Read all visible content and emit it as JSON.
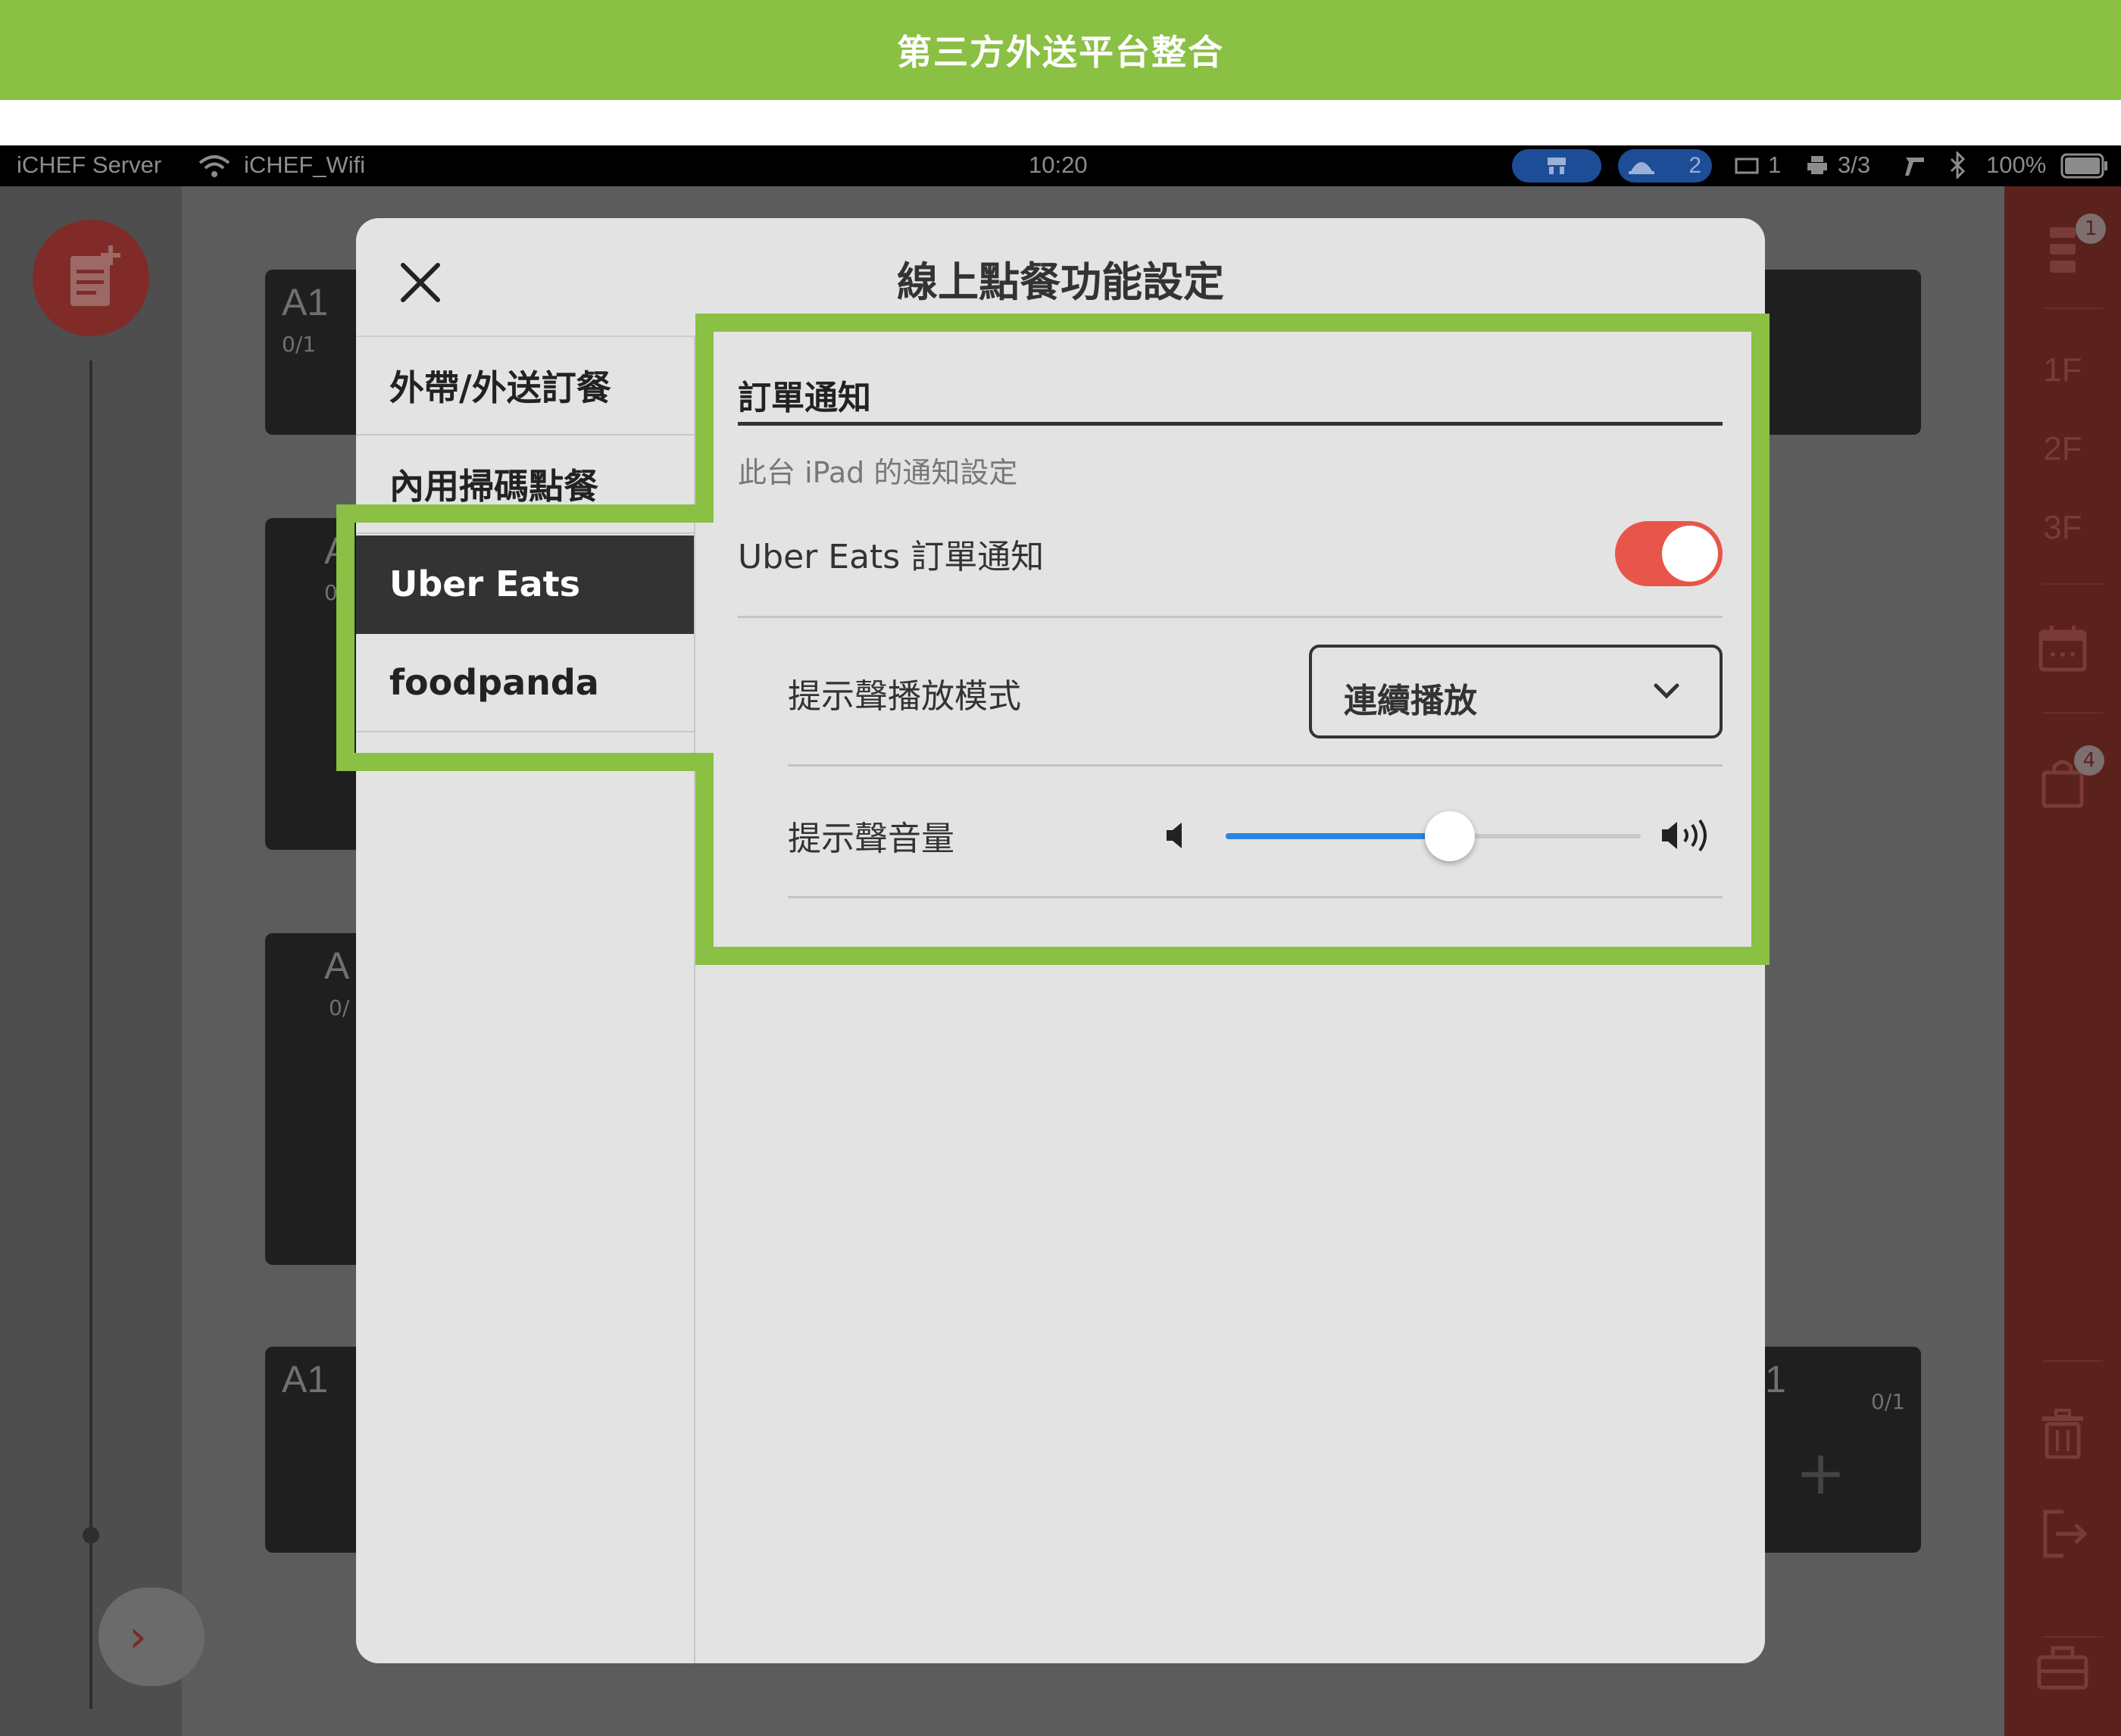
{
  "banner": {
    "title": "第三方外送平台整合"
  },
  "status_bar": {
    "server": "iCHEF Server",
    "wifi": "iCHEF_Wifi",
    "time": "10:20",
    "pill2_count": "2",
    "drawer_count": "1",
    "printer_count": "3/3",
    "battery": "100%"
  },
  "tables": [
    {
      "name": "A1",
      "count": "0/1"
    },
    {
      "name": "A",
      "count": "0"
    },
    {
      "name": "A",
      "count": "0/"
    },
    {
      "name": "A1",
      "count": ""
    },
    {
      "name": "1",
      "count": "0/1"
    }
  ],
  "right_rail": {
    "floors": [
      "1F",
      "2F",
      "3F"
    ],
    "top_badge": "1",
    "calendar_badge": "4"
  },
  "modal": {
    "title": "線上點餐功能設定",
    "sidebar": [
      "外帶/外送訂餐",
      "內用掃碼點餐",
      "Uber Eats",
      "foodpanda"
    ],
    "section_title": "訂單通知",
    "section_subtitle": "此台 iPad 的通知設定",
    "notify_label": "Uber Eats 訂單通知",
    "notify_enabled": true,
    "sound_mode_label": "提示聲播放模式",
    "sound_mode_value": "連續播放",
    "volume_label": "提示聲音量",
    "volume_level": 0.54
  },
  "colors": {
    "accent_green": "#8ac043",
    "toggle_on": "#e8564b",
    "slider_fill": "#2a84e0"
  }
}
